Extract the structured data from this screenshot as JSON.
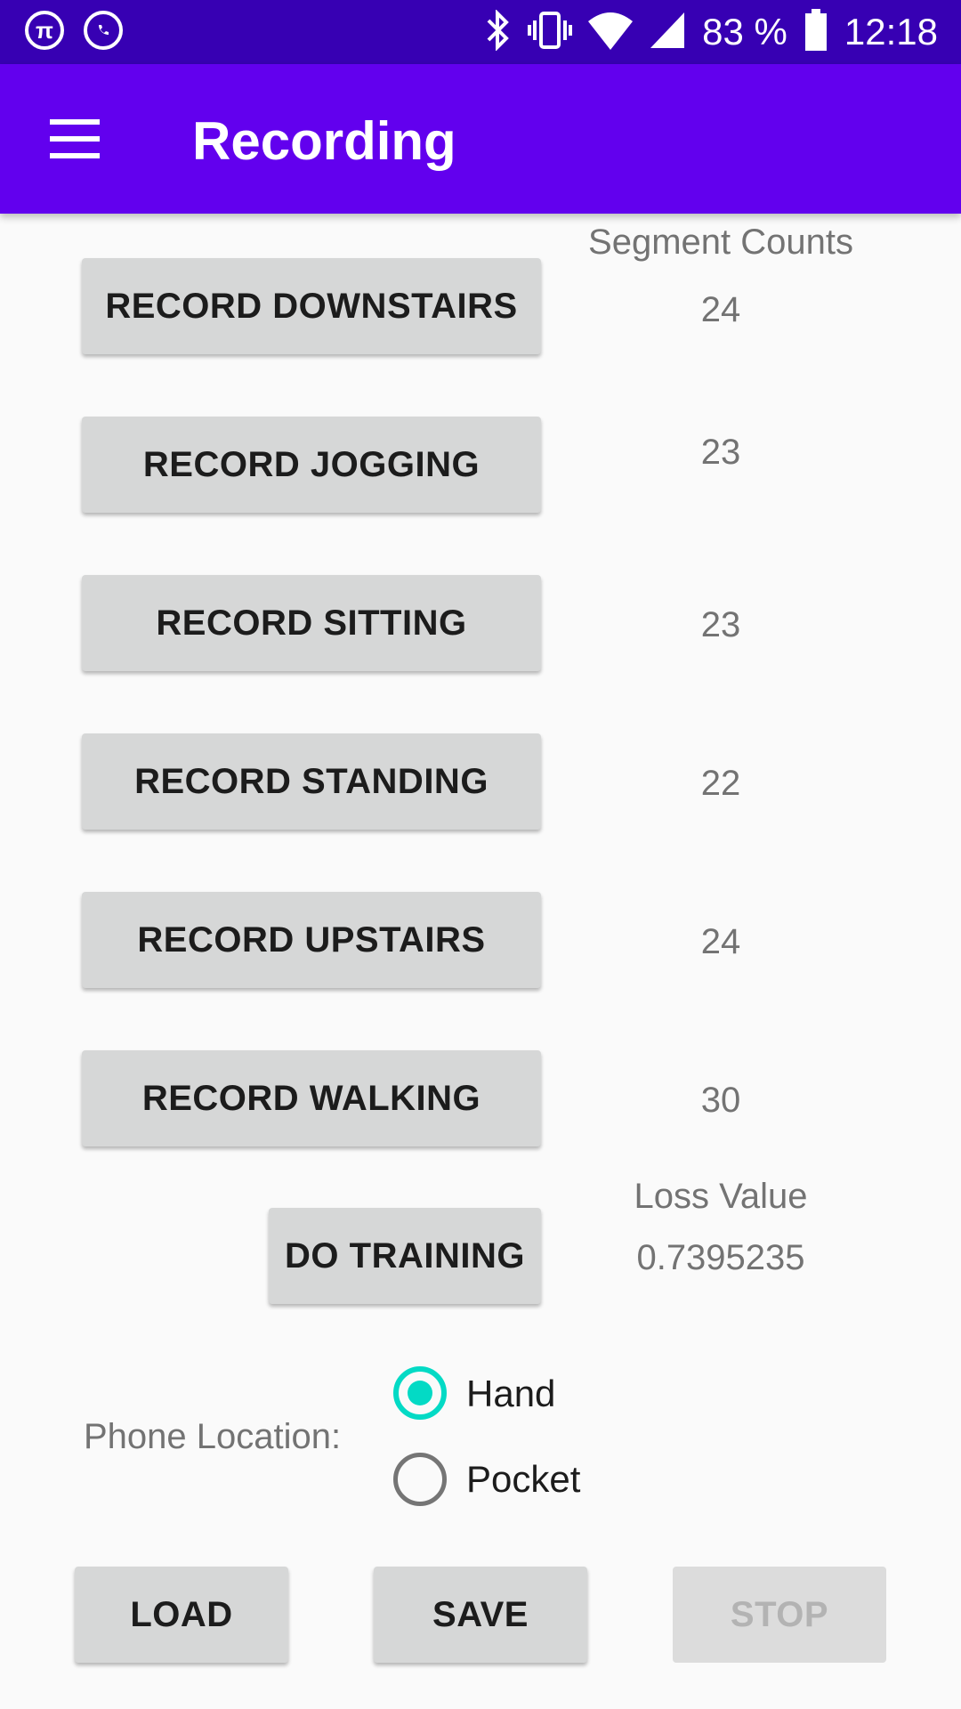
{
  "status_bar": {
    "left_icons": [
      "pi-icon",
      "whatsapp-icon"
    ],
    "right_icons": [
      "bluetooth-icon",
      "vibrate-icon",
      "wifi-icon",
      "cell-signal-icon"
    ],
    "battery_text": "83 %",
    "time": "12:18"
  },
  "app_bar": {
    "title": "Recording",
    "menu_icon": "hamburger-menu-icon",
    "background": "#6200ee"
  },
  "segment_counts_header": "Segment Counts",
  "record_buttons": [
    {
      "label": "RECORD DOWNSTAIRS",
      "count": "24"
    },
    {
      "label": "RECORD JOGGING",
      "count": "23"
    },
    {
      "label": "RECORD SITTING",
      "count": "23"
    },
    {
      "label": "RECORD STANDING",
      "count": "22"
    },
    {
      "label": "RECORD UPSTAIRS",
      "count": "24"
    },
    {
      "label": "RECORD WALKING",
      "count": "30"
    }
  ],
  "training": {
    "button_label": "DO TRAINING",
    "loss_header": "Loss Value",
    "loss_value": "0.7395235"
  },
  "phone_location": {
    "label": "Phone Location:",
    "options": [
      {
        "label": "Hand",
        "selected": true
      },
      {
        "label": "Pocket",
        "selected": false
      }
    ],
    "accent": "#03dac5"
  },
  "bottom_buttons": {
    "load": "LOAD",
    "save": "SAVE",
    "stop": "STOP",
    "stop_enabled": false
  }
}
